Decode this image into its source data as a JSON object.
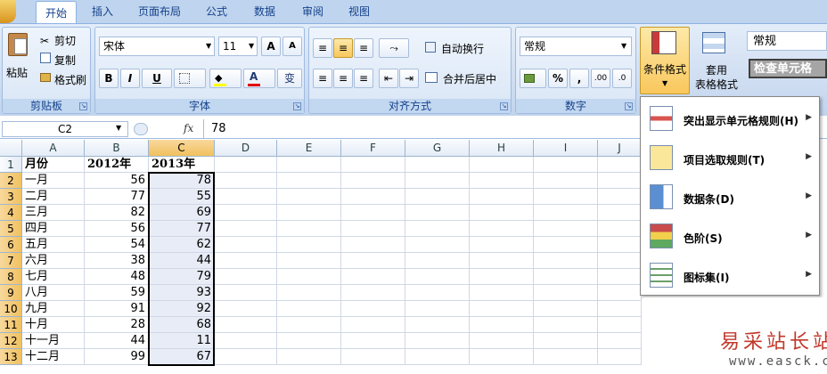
{
  "tabs": [
    "开始",
    "插入",
    "页面布局",
    "公式",
    "数据",
    "审阅",
    "视图"
  ],
  "clipboard": {
    "paste": "粘贴",
    "cut": "剪切",
    "copy": "复制",
    "format_painter": "格式刷",
    "label": "剪贴板"
  },
  "font": {
    "name": "宋体",
    "size": "11",
    "bold": "B",
    "italic": "I",
    "underline": "U",
    "label": "字体",
    "grow": "A",
    "shrink": "A",
    "font_color_glyph": "A",
    "phonetic": "变"
  },
  "alignment": {
    "wrap": "自动换行",
    "merge": "合并后居中",
    "label": "对齐方式"
  },
  "number": {
    "format": "常规",
    "percent": "%",
    "comma": ",",
    "label": "数字",
    "inc_decimal": ".00",
    "dec_decimal": ".0"
  },
  "styles": {
    "conditional": "条件格式",
    "table_format_1": "套用",
    "table_format_2": "表格格式",
    "style_normal": "常规",
    "style_check": "检查单元格"
  },
  "formula_bar": {
    "name_box": "C2",
    "fx": "fx",
    "value": "78"
  },
  "columns": [
    "A",
    "B",
    "C",
    "D",
    "E",
    "F",
    "G",
    "H",
    "I",
    "J"
  ],
  "rows": [
    "1",
    "2",
    "3",
    "4",
    "5",
    "6",
    "7",
    "8",
    "9",
    "10",
    "11",
    "12",
    "13"
  ],
  "table": {
    "header": [
      "月份",
      "2012年",
      "2013年"
    ],
    "data": [
      [
        "一月",
        "56",
        "78"
      ],
      [
        "二月",
        "77",
        "55"
      ],
      [
        "三月",
        "82",
        "69"
      ],
      [
        "四月",
        "56",
        "77"
      ],
      [
        "五月",
        "54",
        "62"
      ],
      [
        "六月",
        "38",
        "44"
      ],
      [
        "七月",
        "48",
        "79"
      ],
      [
        "八月",
        "59",
        "93"
      ],
      [
        "九月",
        "91",
        "92"
      ],
      [
        "十月",
        "28",
        "68"
      ],
      [
        "十一月",
        "44",
        "11"
      ],
      [
        "十二月",
        "99",
        "67"
      ]
    ]
  },
  "menu": [
    {
      "label": "突出显示单元格规则(H)",
      "icon": "highlight-rules-icon"
    },
    {
      "label": "项目选取规则(T)",
      "icon": "top-bottom-rules-icon"
    },
    {
      "label": "数据条(D)",
      "icon": "data-bars-icon"
    },
    {
      "label": "色阶(S)",
      "icon": "color-scales-icon"
    },
    {
      "label": "图标集(I)",
      "icon": "icon-sets-icon"
    }
  ],
  "watermark": {
    "title": "易采站长站",
    "url": "www.easck.com"
  },
  "colors": {
    "accent": "#15428b",
    "selection": "#e8ecf6",
    "header_sel": "#f1c15f"
  }
}
